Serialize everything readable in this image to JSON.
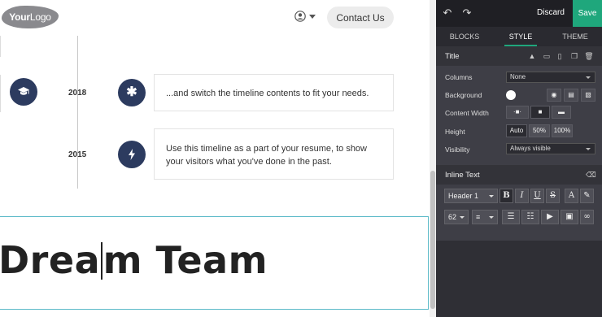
{
  "header": {
    "logo_text_bold": "Your",
    "logo_text_rest": "Logo",
    "contact_label": "Contact Us",
    "user_icon": "user-circle-icon"
  },
  "timeline": {
    "items": [
      {
        "year": "2018",
        "icon": "asterisk-icon",
        "text": "...and switch the timeline contents to fit your needs."
      },
      {
        "year": "2015",
        "icon": "lightning-bolt-icon",
        "text": "Use this timeline as a part of your resume, to show your visitors what you've done in the past."
      }
    ],
    "left_icon": "graduation-cap-icon"
  },
  "title_block": {
    "text_before_cursor": "Dream",
    "text_after_cursor": "m Team",
    "text_before_cursor_short": "Drea"
  },
  "panel": {
    "discard_label": "Discard",
    "save_label": "Save",
    "tabs": [
      "BLOCKS",
      "STYLE",
      "THEME"
    ],
    "active_tab": "STYLE",
    "title_section": {
      "title": "Title",
      "options": {
        "columns_label": "Columns",
        "columns_value": "None",
        "background_label": "Background",
        "content_width_label": "Content Width",
        "height_label": "Height",
        "height_options": [
          "Auto",
          "50%",
          "100%"
        ],
        "visibility_label": "Visibility",
        "visibility_value": "Always visible"
      }
    },
    "inline_text": {
      "title": "Inline Text",
      "heading_value": "Header 1",
      "bold": "B",
      "italic": "I",
      "underline": "U",
      "strike": "S",
      "font_color": "A",
      "font_size_value": "62"
    },
    "colors": {
      "accent": "#1fa77c",
      "panel_bg": "#3e3e46",
      "timeline_circle": "#2c3b5f",
      "selection_border": "#5bbac8"
    }
  }
}
